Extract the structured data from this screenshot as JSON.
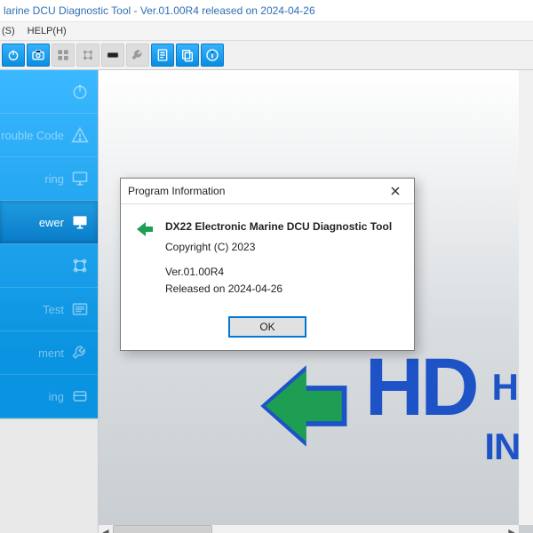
{
  "title": "larine DCU Diagnostic Tool - Ver.01.00R4 released on 2024-04-26",
  "menu": {
    "item0": "(S)",
    "item1": "HELP(H)"
  },
  "sidebar": {
    "items": [
      {
        "label": ""
      },
      {
        "label": "rouble Code"
      },
      {
        "label": "ring"
      },
      {
        "label": "ewer"
      },
      {
        "label": ""
      },
      {
        "label": "Test"
      },
      {
        "label": "ment"
      },
      {
        "label": "ing"
      }
    ]
  },
  "logo": {
    "big": "HD",
    "line1": "HY",
    "line2": "INF"
  },
  "dialog": {
    "title": "Program Information",
    "product": "DX22 Electronic Marine DCU Diagnostic Tool",
    "copyright": "Copyright (C) 2023",
    "version": "Ver.01.00R4",
    "released": "Released on 2024-04-26",
    "ok": "OK"
  }
}
